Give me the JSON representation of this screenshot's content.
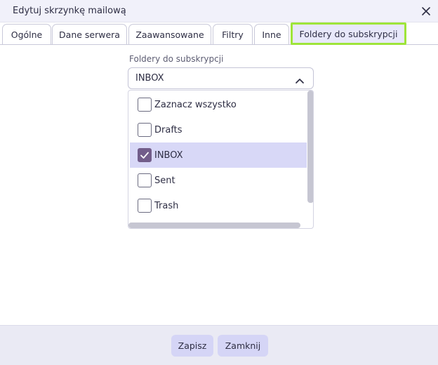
{
  "dialog": {
    "title": "Edytuj skrzynkę mailową",
    "close_icon": "close-icon"
  },
  "tabs": [
    {
      "label": "Ogólne"
    },
    {
      "label": "Dane serwera"
    },
    {
      "label": "Zaawansowane"
    },
    {
      "label": "Filtry"
    },
    {
      "label": "Inne"
    },
    {
      "label": "Foldery do subskrypcji",
      "active": true
    }
  ],
  "field": {
    "label": "Foldery do subskrypcji",
    "value": "INBOX",
    "chevron_icon": "chevron-up-icon"
  },
  "options": [
    {
      "label": "Zaznacz wszystko",
      "checked": false
    },
    {
      "label": "Drafts",
      "checked": false
    },
    {
      "label": "INBOX",
      "checked": true
    },
    {
      "label": "Sent",
      "checked": false
    },
    {
      "label": "Trash",
      "checked": false
    }
  ],
  "footer": {
    "save_label": "Zapisz",
    "close_label": "Zamknij"
  },
  "colors": {
    "active_tab_border": "#9ee53a",
    "selected_option_bg": "#d8d8f7",
    "checkbox_checked": "#725d8a",
    "button_bg": "#d5d5f6"
  }
}
